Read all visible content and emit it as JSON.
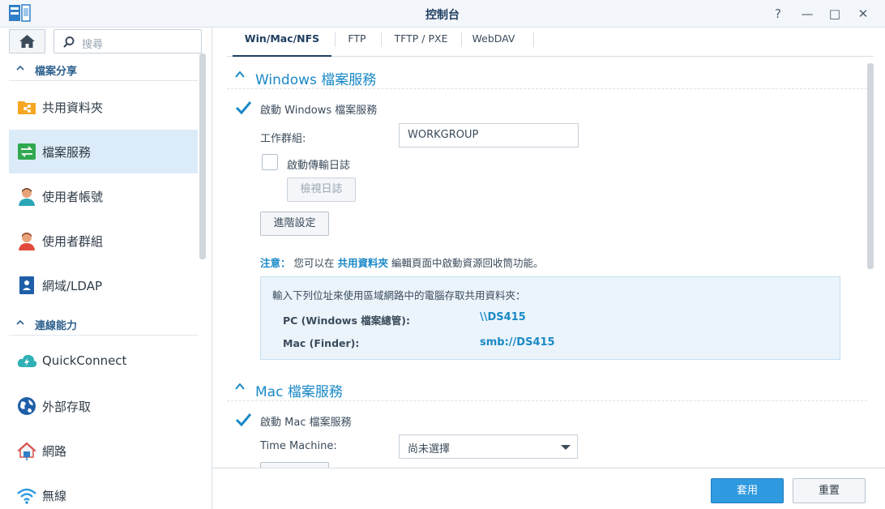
{
  "window": {
    "title": "控制台",
    "help_label": "?",
    "minimize_label": "—",
    "maximize_label": "□",
    "close_label": "✕"
  },
  "sidebar": {
    "search_placeholder": "搜尋",
    "sections": [
      {
        "label": "檔案分享"
      },
      {
        "label": "連線能力"
      }
    ],
    "items": [
      {
        "label": "共用資料夾",
        "icon": "shared-folder-icon"
      },
      {
        "label": "檔案服務",
        "icon": "file-services-icon"
      },
      {
        "label": "使用者帳號",
        "icon": "user-icon"
      },
      {
        "label": "使用者群組",
        "icon": "group-icon"
      },
      {
        "label": "網域/LDAP",
        "icon": "domain-ldap-icon"
      },
      {
        "label": "QuickConnect",
        "icon": "quickconnect-icon"
      },
      {
        "label": "外部存取",
        "icon": "external-access-icon"
      },
      {
        "label": "網路",
        "icon": "network-icon"
      },
      {
        "label": "無線",
        "icon": "wireless-icon"
      }
    ]
  },
  "tabs": [
    {
      "label": "Win/Mac/NFS"
    },
    {
      "label": "FTP"
    },
    {
      "label": "TFTP / PXE"
    },
    {
      "label": "WebDAV"
    }
  ],
  "windows": {
    "section_title": "Windows 檔案服務",
    "enable_label": "啟動 Windows 檔案服務",
    "workgroup_label": "工作群組:",
    "workgroup_value": "WORKGROUP",
    "transfer_log_label": "啟動傳輸日誌",
    "view_log_button": "檢視日誌",
    "advanced_button": "進階設定",
    "note_prefix": "注意：",
    "note_text_1": "您可以在",
    "note_link": "共用資料夾",
    "note_text_2": "編輯頁面中啟動資源回收筒功能。",
    "info_intro": "輸入下列位址來使用區域網路中的電腦存取共用資料夾：",
    "pc_label": "PC (Windows 檔案總管):",
    "pc_value": "\\\\DS415",
    "mac_label": "Mac (Finder):",
    "mac_value": "smb://DS415"
  },
  "mac": {
    "section_title": "Mac 檔案服務",
    "enable_label": "啟動 Mac 檔案服務",
    "time_machine_label": "Time Machine:",
    "time_machine_value": "尚未選擇"
  },
  "footer": {
    "apply_label": "套用",
    "reset_label": "重置"
  },
  "colors": {
    "accent": "#1a89c6",
    "active_nav": "#dcebf8",
    "apply_button": "#2f9ae0"
  }
}
